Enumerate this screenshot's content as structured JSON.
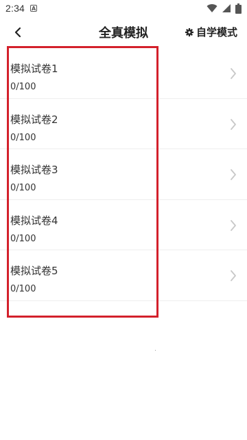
{
  "status": {
    "time": "2:34"
  },
  "header": {
    "title": "全真模拟",
    "self_mode_label": "自学模式"
  },
  "papers": [
    {
      "name": "模拟试卷1",
      "score": "0/100"
    },
    {
      "name": "模拟试卷2",
      "score": "0/100"
    },
    {
      "name": "模拟试卷3",
      "score": "0/100"
    },
    {
      "name": "模拟试卷4",
      "score": "0/100"
    },
    {
      "name": "模拟试卷5",
      "score": "0/100"
    }
  ],
  "colors": {
    "highlight_border": "#d3202b"
  }
}
